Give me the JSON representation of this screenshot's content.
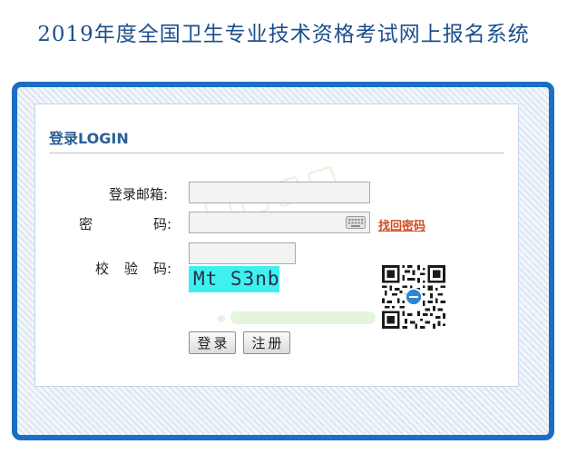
{
  "page": {
    "title": "2019年度全国卫生专业技术资格考试网上报名系统"
  },
  "login": {
    "heading": "登录LOGIN",
    "email_label": "登录邮箱:",
    "email_value": "",
    "password_label_1": "密",
    "password_label_2": "码:",
    "password_value": "",
    "captcha_label_1": "校",
    "captcha_label_2": "验",
    "captcha_label_3": "码:",
    "captcha_value": "",
    "captcha_text": "Mt S3nb",
    "forgot_password": "找回密码",
    "login_button": "登录",
    "register_button": "注册"
  },
  "icons": {
    "keyboard": "keyboard-icon",
    "qr": "qr-code"
  },
  "colors": {
    "title": "#1c4f8c",
    "frame": "#1a6fc4",
    "link": "#d04a1e",
    "captcha_bg": "#3ef0ee"
  }
}
